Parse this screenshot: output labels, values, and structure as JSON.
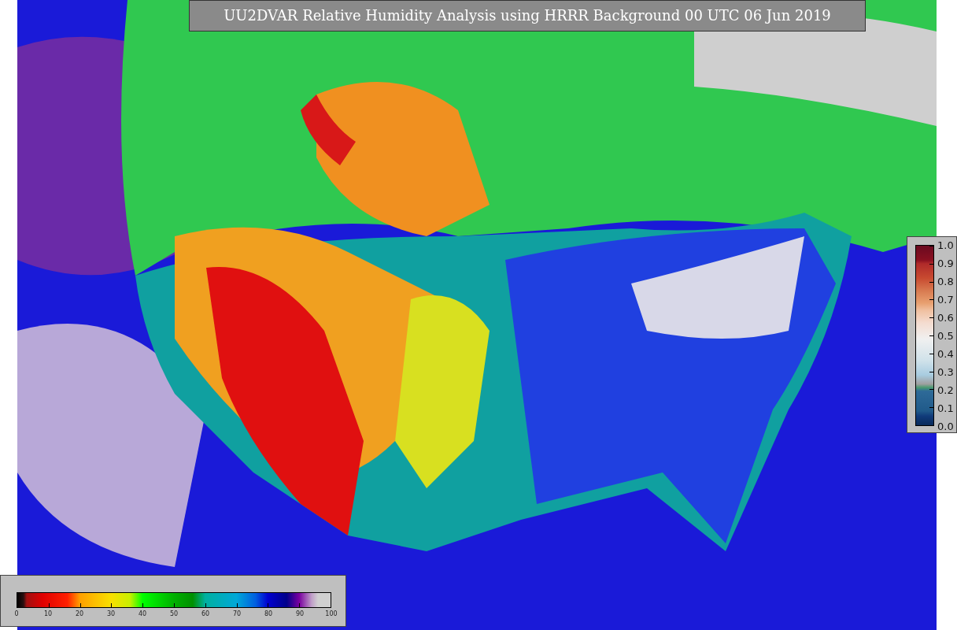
{
  "title": "UU2DVAR Relative Humidity Analysis using HRRR Background 00 UTC 06 Jun 2019",
  "humidity_colorbar": {
    "ticks": [
      "0",
      "10",
      "20",
      "30",
      "40",
      "50",
      "60",
      "70",
      "80",
      "90",
      "100"
    ]
  },
  "observation_colorbar": {
    "ticks": [
      "1.0",
      "0.9",
      "0.8",
      "0.7",
      "0.6",
      "0.5",
      "0.4",
      "0.3",
      "0.2",
      "0.1",
      "0.0"
    ]
  }
}
